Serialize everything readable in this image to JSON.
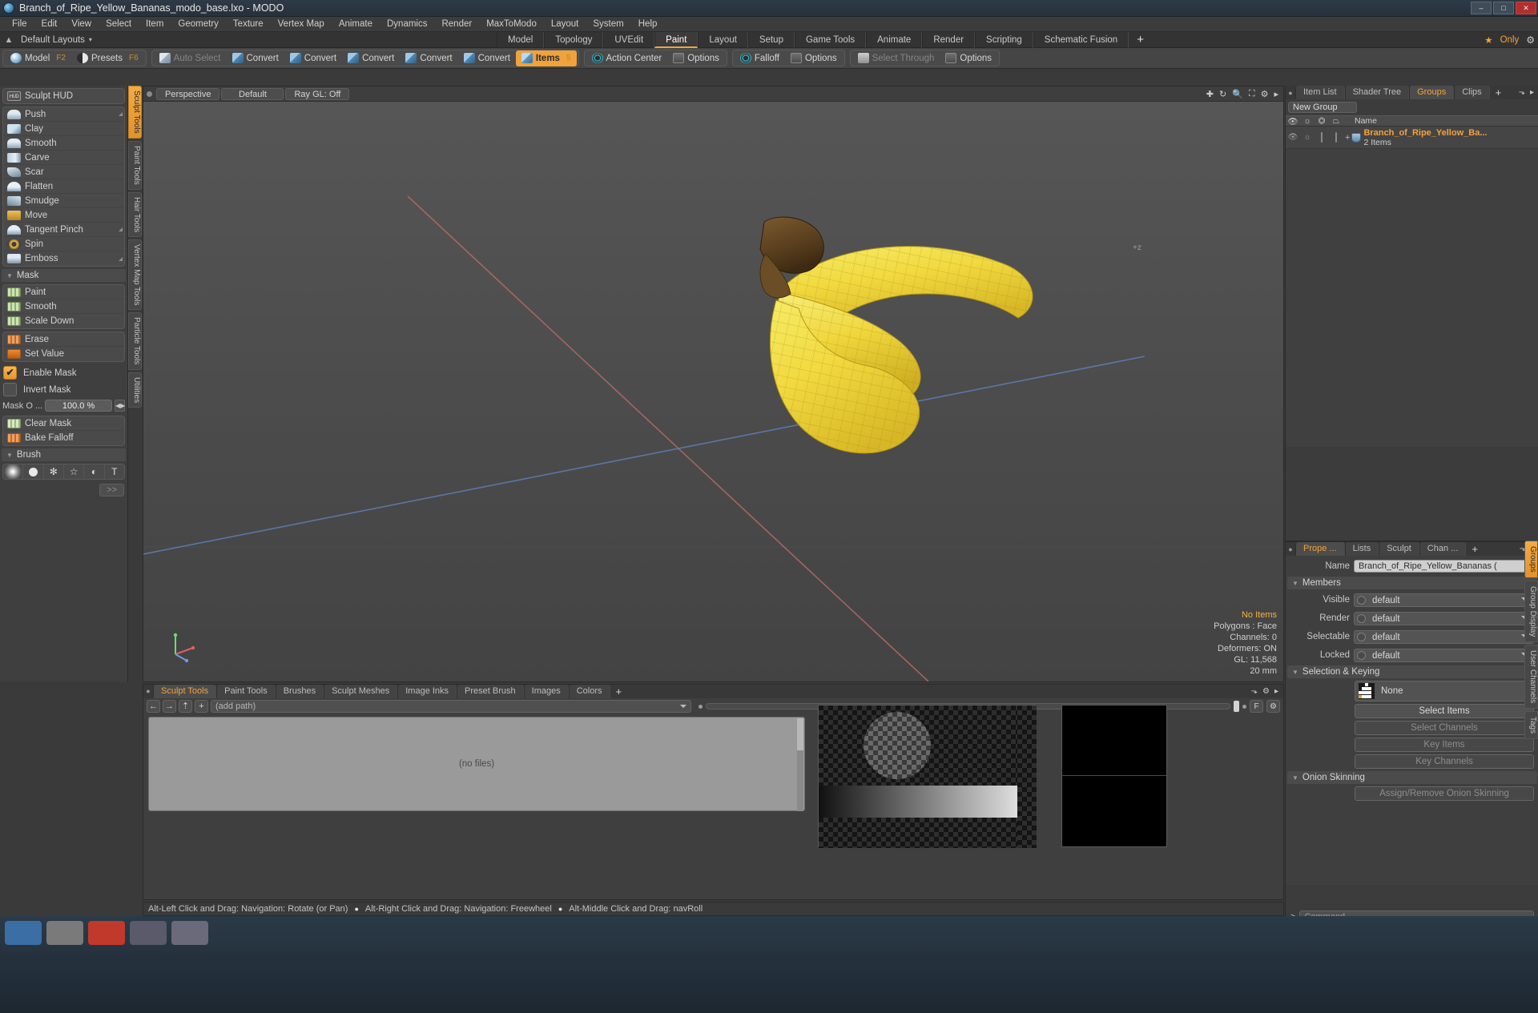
{
  "window": {
    "title": "Branch_of_Ripe_Yellow_Bananas_modo_base.lxo - MODO",
    "app_icon": "modo-logo-icon",
    "minimize": "–",
    "maximize": "□",
    "close": "✕"
  },
  "menubar": {
    "items": [
      "File",
      "Edit",
      "View",
      "Select",
      "Item",
      "Geometry",
      "Texture",
      "Vertex Map",
      "Animate",
      "Dynamics",
      "Render",
      "MaxToModo",
      "Layout",
      "System",
      "Help"
    ]
  },
  "layoutbar": {
    "home_icon": "home-icon",
    "name": "Default Layouts",
    "caret": "▾",
    "tabs": [
      {
        "label": "Model",
        "active": false
      },
      {
        "label": "Topology",
        "active": false
      },
      {
        "label": "UVEdit",
        "active": false
      },
      {
        "label": "Paint",
        "active": true
      },
      {
        "label": "Layout",
        "active": false
      },
      {
        "label": "Setup",
        "active": false
      },
      {
        "label": "Game Tools",
        "active": false
      },
      {
        "label": "Animate",
        "active": false
      },
      {
        "label": "Render",
        "active": false
      },
      {
        "label": "Scripting",
        "active": false
      },
      {
        "label": "Schematic Fusion",
        "active": false
      }
    ],
    "add_tab": "+",
    "only_star": "★",
    "only_label": "Only",
    "gear_icon": "gear-icon"
  },
  "toolbar": {
    "groups": [
      {
        "buttons": [
          {
            "label": "Model",
            "icon": "sphere-icon",
            "key": "F2",
            "state": "normal"
          },
          {
            "label": "Presets",
            "icon": "half-sphere-icon",
            "key": "F6",
            "state": "normal"
          }
        ]
      },
      {
        "buttons": [
          {
            "label": "Auto Select",
            "icon": "cube-icon",
            "key": "",
            "state": "dim"
          },
          {
            "label": "Convert",
            "icon": "cube-blue-icon",
            "key": "",
            "state": "normal"
          },
          {
            "label": "Convert",
            "icon": "cube-blue-icon",
            "key": "",
            "state": "normal"
          },
          {
            "label": "Convert",
            "icon": "cube-blue-icon",
            "key": "",
            "state": "normal"
          },
          {
            "label": "Convert",
            "icon": "cube-blue-icon",
            "key": "",
            "state": "normal"
          },
          {
            "label": "Convert",
            "icon": "cube-blue-icon",
            "key": "",
            "state": "normal"
          },
          {
            "label": "Items",
            "icon": "cube-sel-icon",
            "key": "5",
            "state": "active"
          }
        ]
      },
      {
        "buttons": [
          {
            "label": "Action Center",
            "icon": "action-center-icon",
            "key": "",
            "state": "normal"
          },
          {
            "label": "Options",
            "icon": "options-icon",
            "key": "",
            "state": "normal"
          }
        ]
      },
      {
        "buttons": [
          {
            "label": "Falloff",
            "icon": "falloff-icon",
            "key": "",
            "state": "normal"
          },
          {
            "label": "Options",
            "icon": "options-icon",
            "key": "",
            "state": "normal"
          }
        ]
      },
      {
        "buttons": [
          {
            "label": "Select Through",
            "icon": "select-through-icon",
            "key": "",
            "state": "dim"
          },
          {
            "label": "Options",
            "icon": "options-icon",
            "key": "",
            "state": "normal"
          }
        ]
      }
    ]
  },
  "left_panel": {
    "hud_button": {
      "label": "Sculpt HUD",
      "icon": "hud-icon"
    },
    "sculpt_tools": [
      {
        "label": "Push",
        "icon": "push-icon",
        "corner": true
      },
      {
        "label": "Clay",
        "icon": "clay-icon",
        "corner": false
      },
      {
        "label": "Smooth",
        "icon": "smooth-icon",
        "corner": false
      },
      {
        "label": "Carve",
        "icon": "carve-icon",
        "corner": false
      },
      {
        "label": "Scar",
        "icon": "scar-icon",
        "corner": false
      },
      {
        "label": "Flatten",
        "icon": "flatten-icon",
        "corner": false
      },
      {
        "label": "Smudge",
        "icon": "smudge-icon",
        "corner": false
      },
      {
        "label": "Move",
        "icon": "move-icon",
        "corner": false
      },
      {
        "label": "Tangent Pinch",
        "icon": "tangent-pinch-icon",
        "corner": true
      },
      {
        "label": "Spin",
        "icon": "spin-icon",
        "corner": false
      },
      {
        "label": "Emboss",
        "icon": "emboss-icon",
        "corner": true
      }
    ],
    "mask_header": "Mask",
    "mask_tools_a": [
      {
        "label": "Paint",
        "icon": "mask-paint-icon"
      },
      {
        "label": "Smooth",
        "icon": "mask-smooth-icon"
      },
      {
        "label": "Scale Down",
        "icon": "mask-scale-down-icon"
      }
    ],
    "mask_tools_b": [
      {
        "label": "Erase",
        "icon": "mask-erase-icon"
      },
      {
        "label": "Set Value",
        "icon": "mask-set-value-icon"
      }
    ],
    "enable_mask": {
      "label": "Enable Mask",
      "checked": true
    },
    "invert_mask": {
      "label": "Invert Mask",
      "checked": false
    },
    "mask_opacity": {
      "label": "Mask O  ...",
      "value": "100.0 %"
    },
    "mask_tools_c": [
      {
        "label": "Clear Mask",
        "icon": "clear-mask-icon"
      },
      {
        "label": "Bake Falloff",
        "icon": "bake-falloff-icon"
      }
    ],
    "brush_header": "Brush",
    "brush_icons": [
      "soft-brush-icon",
      "hard-brush-icon",
      "noise-brush-icon",
      "star-brush-icon",
      "spline-brush-icon",
      "text-brush-icon"
    ],
    "brush_more": ">>",
    "vertical_tabs": [
      {
        "label": "Sculpt Tools",
        "active": true
      },
      {
        "label": "Paint Tools",
        "active": false
      },
      {
        "label": "Hair Tools",
        "active": false
      },
      {
        "label": "Vertex Map Tools",
        "active": false
      },
      {
        "label": "Particle Tools",
        "active": false
      },
      {
        "label": "Utilities",
        "active": false
      }
    ]
  },
  "viewport": {
    "dot_icon": "viewport-menu-icon",
    "view_mode": "Perspective",
    "shading": "Default",
    "ray_gl": "Ray GL: Off",
    "icons": [
      "move-gizmo-icon",
      "rotate-gizmo-icon",
      "zoom-icon",
      "fit-icon",
      "gear-icon",
      "chevron-right-icon"
    ],
    "info": {
      "items_label": "No Items",
      "polygons": "Polygons : Face",
      "channels": "Channels: 0",
      "deformers": "Deformers: ON",
      "gl": "GL: 11,568",
      "grid": "20 mm"
    },
    "axis_gizmo": "axis-gizmo-icon",
    "model_description": "yellow banana bunch 3d model wireframe"
  },
  "right_panel": {
    "top_tabs": [
      {
        "label": "Item List",
        "active": false
      },
      {
        "label": "Shader Tree",
        "active": false
      },
      {
        "label": "Groups",
        "active": true
      },
      {
        "label": "Clips",
        "active": false
      }
    ],
    "top_add": "+",
    "new_group_button": "New Group",
    "list_columns": [
      "eye-icon",
      "render-icon",
      "wire-icon",
      "shade-icon",
      "Name"
    ],
    "list_rows": [
      {
        "expand": "+",
        "icon": "group-icon",
        "name": "Branch_of_Ripe_Yellow_Ba...",
        "sub": "2 Items"
      }
    ],
    "prop_tabs": [
      {
        "label": "Prope ...",
        "active": true
      },
      {
        "label": "Lists",
        "active": false
      },
      {
        "label": "Sculpt",
        "active": false
      },
      {
        "label": "Chan ...",
        "active": false
      }
    ],
    "prop_add": "+",
    "name_label": "Name",
    "name_value": "Branch_of_Ripe_Yellow_Bananas (",
    "members_header": "Members",
    "members": [
      {
        "label": "Visible",
        "value": "default"
      },
      {
        "label": "Render",
        "value": "default"
      },
      {
        "label": "Selectable",
        "value": "default"
      },
      {
        "label": "Locked",
        "value": "default"
      }
    ],
    "selection_header": "Selection & Keying",
    "selection_mode": "None",
    "selection_buttons": [
      {
        "label": "Select Items",
        "enabled": true
      },
      {
        "label": "Select Channels",
        "enabled": false
      },
      {
        "label": "Key Items",
        "enabled": false
      },
      {
        "label": "Key Channels",
        "enabled": false
      }
    ],
    "onion_header": "Onion Skinning",
    "onion_button": {
      "label": "Assign/Remove Onion Skinning",
      "enabled": false
    },
    "vertical_tabs": [
      {
        "label": "Groups",
        "active": true
      },
      {
        "label": "Group Display",
        "active": false
      },
      {
        "label": "User Channels",
        "active": false
      },
      {
        "label": "Tags",
        "active": false
      }
    ],
    "command_prompt": ">",
    "command_placeholder": "Command"
  },
  "bottom_panel": {
    "tabs": [
      {
        "label": "Sculpt Tools",
        "active": true
      },
      {
        "label": "Paint Tools",
        "active": false
      },
      {
        "label": "Brushes",
        "active": false
      },
      {
        "label": "Sculpt Meshes",
        "active": false
      },
      {
        "label": "Image Inks",
        "active": false
      },
      {
        "label": "Preset Brush",
        "active": false
      },
      {
        "label": "Images",
        "active": false
      },
      {
        "label": "Colors",
        "active": false
      }
    ],
    "add_tab": "+",
    "nav_buttons": [
      "back-icon",
      "forward-icon",
      "up-icon",
      "add-icon"
    ],
    "path_value": "(add path)",
    "size_buttons": [
      "F",
      "gear-icon"
    ],
    "files_message": "(no files)",
    "preview_a": "brush-alpha-preview",
    "preview_b": "brush-secondary-preview"
  },
  "status_bar": {
    "hints": [
      "Alt-Left Click and Drag: Navigation: Rotate (or Pan)",
      "Alt-Right Click and Drag: Navigation: Freewheel",
      "Alt-Middle Click and Drag: navRoll"
    ],
    "bullet": "●"
  }
}
